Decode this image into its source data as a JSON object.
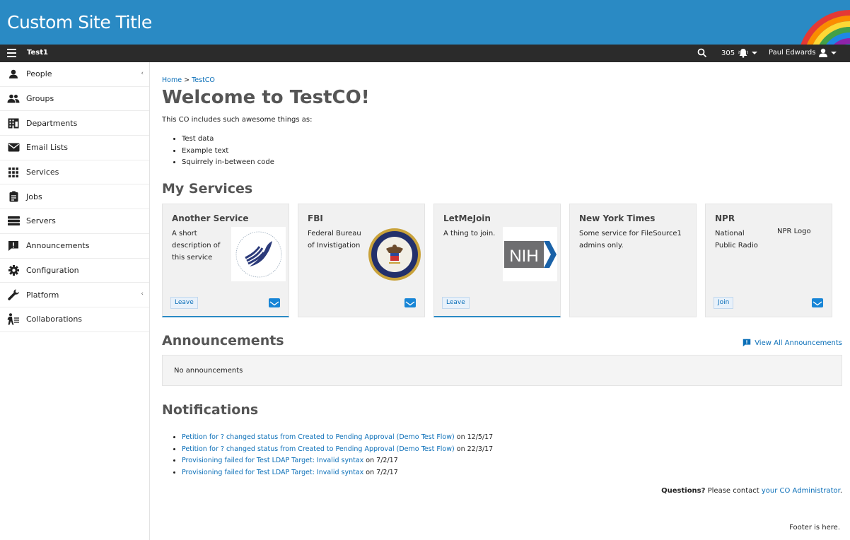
{
  "site_title": "Custom Site Title",
  "topbar": {
    "co_name": "Test1",
    "notification_count": "305",
    "user_name": "Paul Edwards"
  },
  "sidebar": {
    "items": [
      {
        "label": "People",
        "icon": "person-icon",
        "expandable": true
      },
      {
        "label": "Groups",
        "icon": "group-icon",
        "expandable": false
      },
      {
        "label": "Departments",
        "icon": "building-icon",
        "expandable": false
      },
      {
        "label": "Email Lists",
        "icon": "envelope-icon",
        "expandable": false
      },
      {
        "label": "Services",
        "icon": "grid-icon",
        "expandable": false
      },
      {
        "label": "Jobs",
        "icon": "clipboard-icon",
        "expandable": false
      },
      {
        "label": "Servers",
        "icon": "server-icon",
        "expandable": false
      },
      {
        "label": "Announcements",
        "icon": "announcement-icon",
        "expandable": false
      },
      {
        "label": "Configuration",
        "icon": "gear-icon",
        "expandable": false
      },
      {
        "label": "Platform",
        "icon": "wrench-icon",
        "expandable": true
      },
      {
        "label": "Collaborations",
        "icon": "collaborations-icon",
        "expandable": false
      }
    ]
  },
  "breadcrumb": {
    "home": "Home",
    "separator": ">",
    "current": "TestCO"
  },
  "page_title": "Welcome to TestCO!",
  "intro": "This CO includes such awesome things as:",
  "bullets": [
    "Test data",
    "Example text",
    "Squirrely in-between code"
  ],
  "services_heading": "My Services",
  "services": [
    {
      "name": "Another Service",
      "description": "A short description of this service",
      "logo": "hhs-seal-logo",
      "action": "Leave",
      "has_mail": true
    },
    {
      "name": "FBI",
      "description": "Federal Bureau of Invistigation",
      "logo": "doj-seal-logo",
      "action": "",
      "has_mail": true
    },
    {
      "name": "LetMeJoin",
      "description": "A thing to join.",
      "logo": "nih-logo",
      "logo_text": "NIH",
      "action": "Leave",
      "has_mail": false
    },
    {
      "name": "New York Times",
      "description": "Some service for FileSource1 admins only.",
      "logo": "",
      "action": "",
      "has_mail": false
    },
    {
      "name": "NPR",
      "description": "National Public Radio",
      "logo_alt": "NPR Logo",
      "action": "Join",
      "has_mail": true
    }
  ],
  "announcements": {
    "heading": "Announcements",
    "view_all": "View All Announcements",
    "empty": "No announcements"
  },
  "notifications": {
    "heading": "Notifications",
    "items": [
      {
        "link": "Petition for ? changed status from Created to Pending Approval (Demo Test Flow)",
        "suffix": " on 12/5/17"
      },
      {
        "link": "Petition for ? changed status from Created to Pending Approval (Demo Test Flow)",
        "suffix": " on 22/3/17"
      },
      {
        "link": "Provisioning failed for Test LDAP Target: Invalid syntax",
        "suffix": " on 7/2/17"
      },
      {
        "link": "Provisioning failed for Test LDAP Target: Invalid syntax",
        "suffix": " on 7/2/17"
      }
    ]
  },
  "questions": {
    "bold": "Questions?",
    "text": " Please contact ",
    "link": "your CO Administrator",
    "end": "."
  },
  "footer": "Footer is here.",
  "colors": {
    "banner": "#2a8ac4",
    "topbar": "#2b2b2b",
    "link": "#0b6fb8",
    "accent": "#1785d6"
  }
}
